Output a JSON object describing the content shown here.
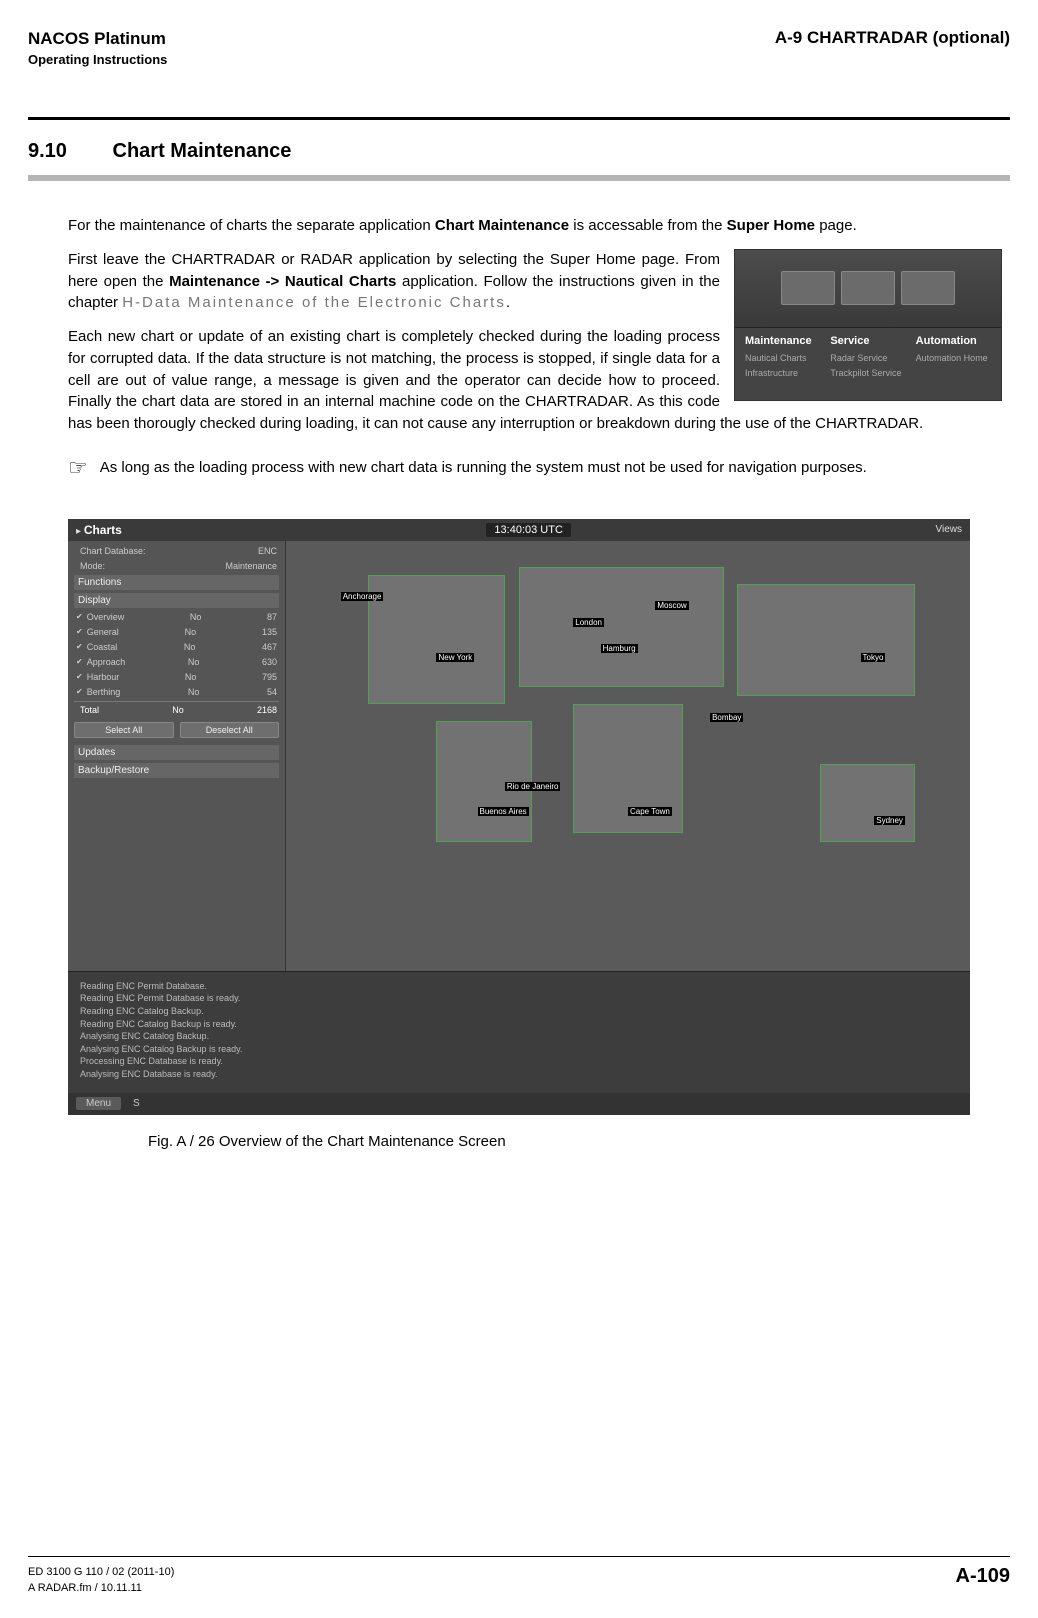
{
  "header": {
    "title": "NACOS Platinum",
    "subtitle": "Operating Instructions",
    "chapter": "A-9  CHARTRADAR (optional)"
  },
  "section": {
    "number": "9.10",
    "title": "Chart Maintenance"
  },
  "para1_a": "For the maintenance of charts the separate application ",
  "para1_b": "Chart Maintenance",
  "para1_c": " is accessable from the ",
  "para1_d": "Super Home",
  "para1_e": " page.",
  "para2_a": "First leave the CHARTRADAR or RADAR application by selecting the Super Home page. From here open the ",
  "para2_b": "Maintenance -> Nautical Charts",
  "para2_c": " application. Follow the instructions given in the chapter ",
  "para2_d": "H-Data Maintenance of the Electronic Charts",
  "para2_e": ".",
  "para3": "Each new chart or update of an existing chart is completely checked during the loading process for corrupted data. If the data structure is not matching, the process is stopped, if single data for a cell are out of value range, a message is given and the operator can decide how to proceed. Finally the chart data are stored in an internal machine code on the CHARTRADAR. As this code has been thorougly checked during loading, it can not cause any interruption or breakdown during the use of the CHARTRADAR.",
  "note": "As long as the loading process with new chart data is running the system must not be used for navigation purposes.",
  "thumb": {
    "col1_h": "Maintenance",
    "col1_a": "Nautical Charts",
    "col1_b": "Infrastructure",
    "col2_h": "Service",
    "col2_a": "Radar Service",
    "col2_b": "Trackpilot Service",
    "col3_h": "Automation",
    "col3_a": "Automation Home"
  },
  "figure": {
    "title": "Charts",
    "time": "13:40:03 UTC",
    "views": "Views",
    "db_label": "Chart Database:",
    "db_val": "ENC",
    "mode_label": "Mode:",
    "mode_val": "Maintenance",
    "tab_functions": "Functions",
    "tab_display": "Display",
    "rows": [
      {
        "name": "Overview",
        "col": "No",
        "val": "87"
      },
      {
        "name": "General",
        "col": "No",
        "val": "135"
      },
      {
        "name": "Coastal",
        "col": "No",
        "val": "467"
      },
      {
        "name": "Approach",
        "col": "No",
        "val": "630"
      },
      {
        "name": "Harbour",
        "col": "No",
        "val": "795"
      },
      {
        "name": "Berthing",
        "col": "No",
        "val": "54"
      }
    ],
    "total_label": "Total",
    "total_col": "No",
    "total_val": "2168",
    "btn_select": "Select All",
    "btn_deselect": "Deselect All",
    "row_updates": "Updates",
    "row_backup": "Backup/Restore",
    "cities": {
      "anchorage": "Anchorage",
      "newyork": "New York",
      "london": "London",
      "moscow": "Moscow",
      "hamburg": "Hamburg",
      "tokyo": "Tokyo",
      "rio": "Rio de Janeiro",
      "buenos": "Buenos Aires",
      "cape": "Cape Town",
      "sydney": "Sydney",
      "bombay": "Bombay"
    },
    "log": [
      "Reading ENC Permit Database.",
      "Reading ENC Permit Database is ready.",
      "",
      "Reading ENC Catalog Backup.",
      "Reading ENC Catalog Backup is ready.",
      "Analysing ENC Catalog Backup.",
      "",
      "Analysing ENC Catalog Backup is ready.",
      "Processing ENC Database is ready.",
      "Analysing ENC Database is ready."
    ],
    "menu": "Menu",
    "s": "S"
  },
  "caption": "Fig. A /  26   Overview of the Chart Maintenance Screen",
  "footer": {
    "line1": "ED 3100 G 110 / 02 (2011-10)",
    "line2": "A RADAR.fm / 10.11.11",
    "page": "A-109"
  }
}
